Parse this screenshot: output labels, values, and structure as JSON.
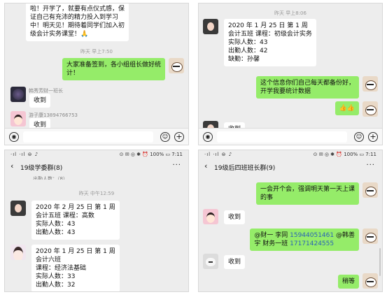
{
  "p1": {
    "top_bubble": "啦！开学了，就要有点仪式感，保\n证自己有充沛的精力投入到学习\n中！明天见！期待着同学们加入初\n级会计实务课堂！🙏",
    "time": "昨天 早上7:50",
    "green_bubble": "大家准备签到，各小组组长做好统\n计！",
    "name1": "韩秀芳财一班长",
    "msg1": "收到",
    "name2": "游子康13894766753",
    "msg2": "收到"
  },
  "p2": {
    "time": "昨天 早上8:06",
    "report": "2020 年 1 月 25 日 第 1 周\n会计五班   课程：初级会计实务\n实际人数：43\n出勤人数：42\n缺勤：孙馨",
    "green_bubble": "这个信息你们自己每天都备份好，\n开学我要统计数据",
    "thumbs": "👍👍",
    "msg_bottom": "收到"
  },
  "p3": {
    "status_left": "·ıl ·ıl ⊜ ♪",
    "status_right": "⊙ ✉ ◎ ✱ ⏰ 100% ▭ 7:11",
    "title": "19级学委群(8)",
    "more": "···",
    "partial": "出勤人数：（8）",
    "time": "昨天 中午12:59",
    "report1": "2020 年 2 月 25 日 第 1 周\n会计五班    课程：高数\n实际人数：43\n出勤人数：43",
    "report2": "2020 年 1 月 25 日 第 1 周\n会计六班\n课程：经济法基础\n实际人数：33\n出勤人数：32"
  },
  "p4": {
    "status_left": "·ıl ·ıl ⊜ ♪",
    "status_right": "⊙ ✉ ◎ ✱ ⏰ 100% ▭ 7:11",
    "title": "19级后四班班长群(9)",
    "more": "···",
    "green1": "一会开个会，强调明天第一天上课\n的事",
    "msg1": "收到",
    "mention_a": "@财一 李同 ",
    "phone_a": "15944051461",
    "mention_b": " @韩善\n宇 财务一班 ",
    "phone_b": "17171424555",
    "msg2": "收到",
    "green2": "稍等"
  },
  "icons": {
    "voice": "◉",
    "emoji": "☺",
    "plus": "+",
    "back": "‹"
  },
  "colors": {
    "green_bubble": "#95ec69",
    "chat_bg": "#ededed",
    "link": "#2a62b6"
  }
}
